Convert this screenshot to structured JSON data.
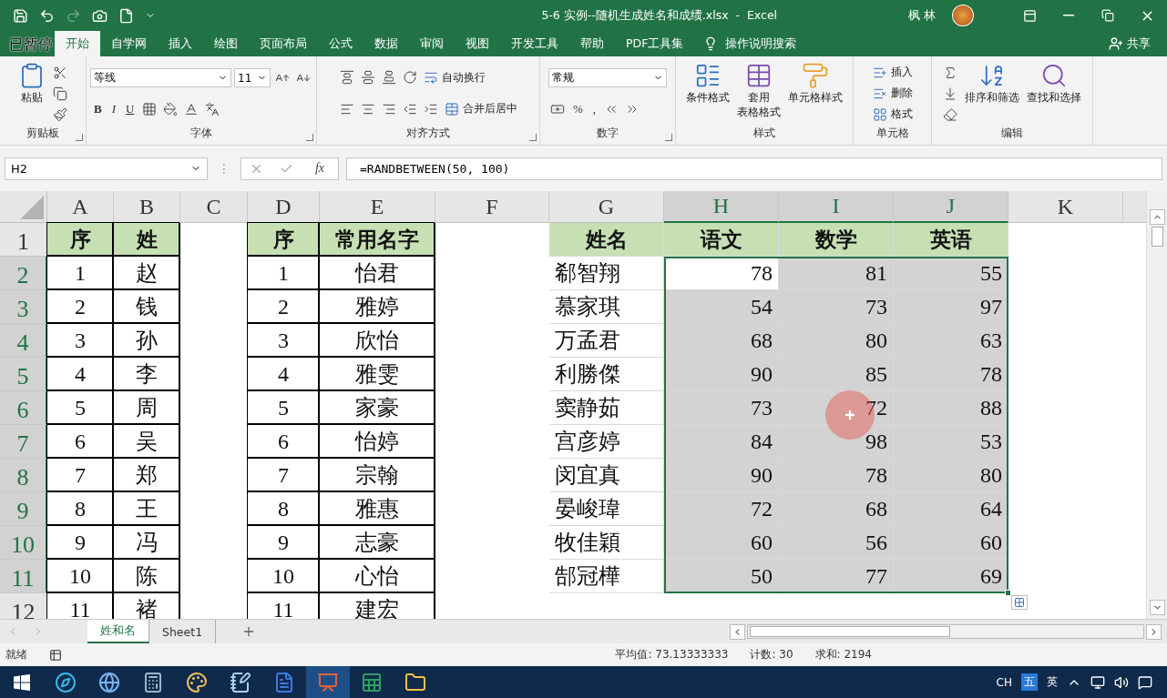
{
  "title_bar": {
    "title": "5-6 实例--随机生成姓名和成绩.xlsx  -  Excel",
    "user": "枫 林"
  },
  "overlay_label": "已暂停",
  "tabs": [
    {
      "label": "开始",
      "selected": true
    },
    {
      "label": "自学网",
      "selected": false
    },
    {
      "label": "插入",
      "selected": false
    },
    {
      "label": "绘图",
      "selected": false
    },
    {
      "label": "页面布局",
      "selected": false
    },
    {
      "label": "公式",
      "selected": false
    },
    {
      "label": "数据",
      "selected": false
    },
    {
      "label": "审阅",
      "selected": false
    },
    {
      "label": "视图",
      "selected": false
    },
    {
      "label": "开发工具",
      "selected": false
    },
    {
      "label": "帮助",
      "selected": false
    },
    {
      "label": "PDF工具集",
      "selected": false
    }
  ],
  "tell_me": "操作说明搜索",
  "share": "共享",
  "ribbon": {
    "groups": [
      {
        "label": "剪贴板",
        "items": [
          {
            "kind": "large",
            "label": "粘贴"
          },
          {
            "kind": "stack",
            "rows": [
              {
                "items": [
                  {
                    "kind": "icon"
                  }
                ]
              },
              {
                "items": [
                  {
                    "kind": "icon"
                  }
                ]
              },
              {
                "items": [
                  {
                    "kind": "icon"
                  }
                ]
              }
            ]
          }
        ]
      },
      {
        "label": "字体",
        "items": [
          {
            "kind": "stack",
            "rows": [
              {
                "items": [
                  {
                    "kind": "dropdown",
                    "value": "等线"
                  },
                  {
                    "kind": "dropdown",
                    "value": "11"
                  },
                  {
                    "kind": "icon"
                  },
                  {
                    "kind": "icon"
                  }
                ]
              },
              {
                "items": [
                  {
                    "kind": "letter",
                    "label": "B"
                  },
                  {
                    "kind": "letter",
                    "label": "I"
                  },
                  {
                    "kind": "letter",
                    "label": "U"
                  },
                  {
                    "kind": "icon"
                  },
                  {
                    "kind": "icon"
                  },
                  {
                    "kind": "icon"
                  },
                  {
                    "kind": "icon"
                  }
                ]
              }
            ]
          }
        ]
      },
      {
        "label": "对齐方式",
        "items": [
          {
            "kind": "stack",
            "rows": [
              {
                "items": [
                  {
                    "kind": "icon"
                  },
                  {
                    "kind": "icon"
                  },
                  {
                    "kind": "icon"
                  },
                  {
                    "kind": "icon"
                  },
                  {
                    "kind": "small",
                    "label": "自动换行"
                  }
                ]
              },
              {
                "items": [
                  {
                    "kind": "icon"
                  },
                  {
                    "kind": "icon"
                  },
                  {
                    "kind": "icon"
                  },
                  {
                    "kind": "icon"
                  },
                  {
                    "kind": "icon"
                  },
                  {
                    "kind": "small",
                    "label": "合并后居中"
                  }
                ]
              }
            ]
          }
        ]
      },
      {
        "label": "数字",
        "items": [
          {
            "kind": "stack",
            "rows": [
              {
                "items": [
                  {
                    "kind": "dropdown",
                    "value": "常规"
                  }
                ]
              },
              {
                "items": [
                  {
                    "kind": "icon"
                  },
                  {
                    "kind": "letter",
                    "label": "%"
                  },
                  {
                    "kind": "letter",
                    "label": ","
                  },
                  {
                    "kind": "icon"
                  },
                  {
                    "kind": "icon"
                  }
                ]
              }
            ]
          }
        ]
      },
      {
        "label": "样式",
        "items": [
          {
            "kind": "large",
            "label": "条件格式"
          },
          {
            "kind": "large",
            "lines": [
              "套用",
              "表格格式"
            ]
          },
          {
            "kind": "large",
            "label": "单元格样式"
          }
        ]
      },
      {
        "label": "单元格",
        "items": [
          {
            "kind": "stack",
            "rows": [
              {
                "items": [
                  {
                    "kind": "small",
                    "label": "插入"
                  }
                ]
              },
              {
                "items": [
                  {
                    "kind": "small",
                    "label": "删除"
                  }
                ]
              },
              {
                "items": [
                  {
                    "kind": "small",
                    "label": "格式"
                  }
                ]
              }
            ]
          }
        ]
      },
      {
        "label": "编辑",
        "items": [
          {
            "kind": "stack",
            "rows": [
              {
                "items": [
                  {
                    "kind": "icon"
                  }
                ]
              },
              {
                "items": [
                  {
                    "kind": "icon"
                  }
                ]
              },
              {
                "items": [
                  {
                    "kind": "icon"
                  }
                ]
              }
            ]
          },
          {
            "kind": "large",
            "label": "排序和筛选"
          },
          {
            "kind": "large",
            "label": "查找和选择"
          }
        ]
      }
    ]
  },
  "formula_bar": {
    "name_box": "H2",
    "splitter": "⋮",
    "fx": "fx",
    "formula": "=RANDBETWEEN(50, 100)"
  },
  "sheet": {
    "columns": [
      {
        "label": "A",
        "selected": false
      },
      {
        "label": "B",
        "selected": false
      },
      {
        "label": "C",
        "selected": false
      },
      {
        "label": "D",
        "selected": false
      },
      {
        "label": "E",
        "selected": false
      },
      {
        "label": "F",
        "selected": false
      },
      {
        "label": "G",
        "selected": false
      },
      {
        "label": "H",
        "selected": true
      },
      {
        "label": "I",
        "selected": true
      },
      {
        "label": "J",
        "selected": true
      },
      {
        "label": "K",
        "selected": false
      }
    ],
    "rows": [
      {
        "label": "1",
        "selected": false,
        "cells": [
          {
            "text": "序",
            "kind": "boxed_header"
          },
          {
            "text": "姓",
            "kind": "boxed_header"
          },
          null,
          {
            "text": "序",
            "kind": "boxed_header"
          },
          {
            "text": "常用名字",
            "kind": "boxed_header"
          },
          null,
          {
            "text": "姓名",
            "kind": "header"
          },
          {
            "text": "语文",
            "kind": "header"
          },
          {
            "text": "数学",
            "kind": "header"
          },
          {
            "text": "英语",
            "kind": "header"
          },
          null
        ]
      },
      {
        "label": "2",
        "selected": true,
        "cells": [
          {
            "text": "1",
            "kind": "boxed"
          },
          {
            "text": "赵",
            "kind": "boxed"
          },
          null,
          {
            "text": "1",
            "kind": "boxed"
          },
          {
            "text": "怡君",
            "kind": "boxed"
          },
          null,
          {
            "text": "郗智翔",
            "kind": "name"
          },
          {
            "text": "78",
            "kind": "number",
            "selected": true,
            "active": true
          },
          {
            "text": "81",
            "kind": "number",
            "selected": true
          },
          {
            "text": "55",
            "kind": "number",
            "selected": true
          },
          null
        ]
      },
      {
        "label": "3",
        "selected": true,
        "cells": [
          {
            "text": "2",
            "kind": "boxed"
          },
          {
            "text": "钱",
            "kind": "boxed"
          },
          null,
          {
            "text": "2",
            "kind": "boxed"
          },
          {
            "text": "雅婷",
            "kind": "boxed"
          },
          null,
          {
            "text": "慕家琪",
            "kind": "name"
          },
          {
            "text": "54",
            "kind": "number",
            "selected": true
          },
          {
            "text": "73",
            "kind": "number",
            "selected": true
          },
          {
            "text": "97",
            "kind": "number",
            "selected": true
          },
          null
        ]
      },
      {
        "label": "4",
        "selected": true,
        "cells": [
          {
            "text": "3",
            "kind": "boxed"
          },
          {
            "text": "孙",
            "kind": "boxed"
          },
          null,
          {
            "text": "3",
            "kind": "boxed"
          },
          {
            "text": "欣怡",
            "kind": "boxed"
          },
          null,
          {
            "text": "万孟君",
            "kind": "name"
          },
          {
            "text": "68",
            "kind": "number",
            "selected": true
          },
          {
            "text": "80",
            "kind": "number",
            "selected": true
          },
          {
            "text": "63",
            "kind": "number",
            "selected": true
          },
          null
        ]
      },
      {
        "label": "5",
        "selected": true,
        "cells": [
          {
            "text": "4",
            "kind": "boxed"
          },
          {
            "text": "李",
            "kind": "boxed"
          },
          null,
          {
            "text": "4",
            "kind": "boxed"
          },
          {
            "text": "雅雯",
            "kind": "boxed"
          },
          null,
          {
            "text": "利勝傑",
            "kind": "name"
          },
          {
            "text": "90",
            "kind": "number",
            "selected": true
          },
          {
            "text": "85",
            "kind": "number",
            "selected": true
          },
          {
            "text": "78",
            "kind": "number",
            "selected": true
          },
          null
        ]
      },
      {
        "label": "6",
        "selected": true,
        "cells": [
          {
            "text": "5",
            "kind": "boxed"
          },
          {
            "text": "周",
            "kind": "boxed"
          },
          null,
          {
            "text": "5",
            "kind": "boxed"
          },
          {
            "text": "家豪",
            "kind": "boxed"
          },
          null,
          {
            "text": "窦静茹",
            "kind": "name"
          },
          {
            "text": "73",
            "kind": "number",
            "selected": true
          },
          {
            "text": "72",
            "kind": "number",
            "selected": true
          },
          {
            "text": "88",
            "kind": "number",
            "selected": true
          },
          null
        ]
      },
      {
        "label": "7",
        "selected": true,
        "cells": [
          {
            "text": "6",
            "kind": "boxed"
          },
          {
            "text": "吴",
            "kind": "boxed"
          },
          null,
          {
            "text": "6",
            "kind": "boxed"
          },
          {
            "text": "怡婷",
            "kind": "boxed"
          },
          null,
          {
            "text": "宫彦婷",
            "kind": "name"
          },
          {
            "text": "84",
            "kind": "number",
            "selected": true
          },
          {
            "text": "98",
            "kind": "number",
            "selected": true
          },
          {
            "text": "53",
            "kind": "number",
            "selected": true
          },
          null
        ]
      },
      {
        "label": "8",
        "selected": true,
        "cells": [
          {
            "text": "7",
            "kind": "boxed"
          },
          {
            "text": "郑",
            "kind": "boxed"
          },
          null,
          {
            "text": "7",
            "kind": "boxed"
          },
          {
            "text": "宗翰",
            "kind": "boxed"
          },
          null,
          {
            "text": "闵宜真",
            "kind": "name"
          },
          {
            "text": "90",
            "kind": "number",
            "selected": true
          },
          {
            "text": "78",
            "kind": "number",
            "selected": true
          },
          {
            "text": "80",
            "kind": "number",
            "selected": true
          },
          null
        ]
      },
      {
        "label": "9",
        "selected": true,
        "cells": [
          {
            "text": "8",
            "kind": "boxed"
          },
          {
            "text": "王",
            "kind": "boxed"
          },
          null,
          {
            "text": "8",
            "kind": "boxed"
          },
          {
            "text": "雅惠",
            "kind": "boxed"
          },
          null,
          {
            "text": "晏峻瑋",
            "kind": "name"
          },
          {
            "text": "72",
            "kind": "number",
            "selected": true
          },
          {
            "text": "68",
            "kind": "number",
            "selected": true
          },
          {
            "text": "64",
            "kind": "number",
            "selected": true
          },
          null
        ]
      },
      {
        "label": "10",
        "selected": true,
        "cells": [
          {
            "text": "9",
            "kind": "boxed"
          },
          {
            "text": "冯",
            "kind": "boxed"
          },
          null,
          {
            "text": "9",
            "kind": "boxed"
          },
          {
            "text": "志豪",
            "kind": "boxed"
          },
          null,
          {
            "text": "牧佳穎",
            "kind": "name"
          },
          {
            "text": "60",
            "kind": "number",
            "selected": true
          },
          {
            "text": "56",
            "kind": "number",
            "selected": true
          },
          {
            "text": "60",
            "kind": "number",
            "selected": true
          },
          null
        ]
      },
      {
        "label": "11",
        "selected": true,
        "cells": [
          {
            "text": "10",
            "kind": "boxed"
          },
          {
            "text": "陈",
            "kind": "boxed"
          },
          null,
          {
            "text": "10",
            "kind": "boxed"
          },
          {
            "text": "心怡",
            "kind": "boxed"
          },
          null,
          {
            "text": "郜冠樺",
            "kind": "name"
          },
          {
            "text": "50",
            "kind": "number",
            "selected": true
          },
          {
            "text": "77",
            "kind": "number",
            "selected": true
          },
          {
            "text": "69",
            "kind": "number",
            "selected": true
          },
          null
        ]
      },
      {
        "label": "12",
        "selected": false,
        "cells": [
          {
            "text": "11",
            "kind": "boxed"
          },
          {
            "text": "褚",
            "kind": "boxed"
          },
          null,
          {
            "text": "11",
            "kind": "boxed"
          },
          {
            "text": "建宏",
            "kind": "boxed"
          },
          null,
          null,
          null,
          null,
          null,
          null
        ]
      }
    ]
  },
  "sheet_tabs": [
    {
      "label": "姓和名",
      "selected": true
    },
    {
      "label": "Sheet1",
      "selected": false
    }
  ],
  "status_bar": {
    "mode": "就绪",
    "average": "平均值: 73.13333333",
    "count": "计数: 30",
    "sum": "求和: 2194"
  },
  "taskbar": {
    "apps": [
      {
        "selected": false
      },
      {
        "selected": false
      },
      {
        "selected": false
      },
      {
        "selected": false
      },
      {
        "selected": false
      },
      {
        "selected": false
      },
      {
        "selected": false
      },
      {
        "selected": true
      },
      {
        "selected": false
      },
      {
        "selected": false
      }
    ],
    "tray": {
      "language": "CH",
      "ime": "五",
      "mode": "英"
    }
  }
}
